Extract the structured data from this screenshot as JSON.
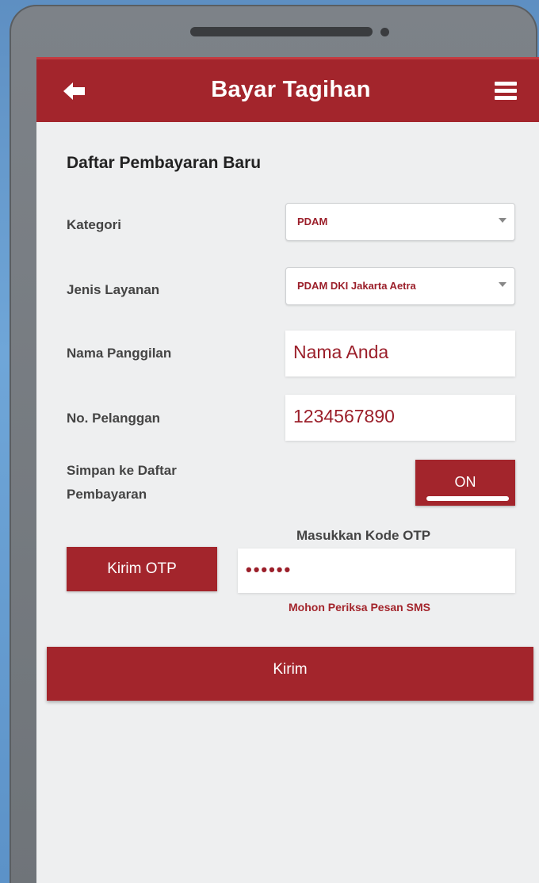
{
  "header": {
    "title": "Bayar Tagihan",
    "back_icon": "arrow-left-icon",
    "menu_icon": "hamburger-menu-icon"
  },
  "form": {
    "section_title": "Daftar Pembayaran Baru",
    "kategori": {
      "label": "Kategori",
      "value": "PDAM"
    },
    "jenis_layanan": {
      "label": "Jenis Layanan",
      "value": "PDAM DKI Jakarta Aetra"
    },
    "nama_panggilan": {
      "label": "Nama Panggilan",
      "value": "Nama Anda"
    },
    "no_pelanggan": {
      "label": "No. Pelanggan",
      "value": "1234567890"
    },
    "simpan": {
      "label_line1": "Simpan ke Daftar",
      "label_line2": "Pembayaran",
      "toggle_state": "ON"
    },
    "otp": {
      "button_label": "Kirim OTP",
      "field_label": "Masukkan Kode OTP",
      "value": "••••••",
      "hint": "Mohon Periksa Pesan SMS"
    },
    "submit_label": "Kirim"
  },
  "colors": {
    "primary": "#a3252c",
    "screen_bg": "#eeeff0",
    "accent_text": "#9b1f2a"
  }
}
